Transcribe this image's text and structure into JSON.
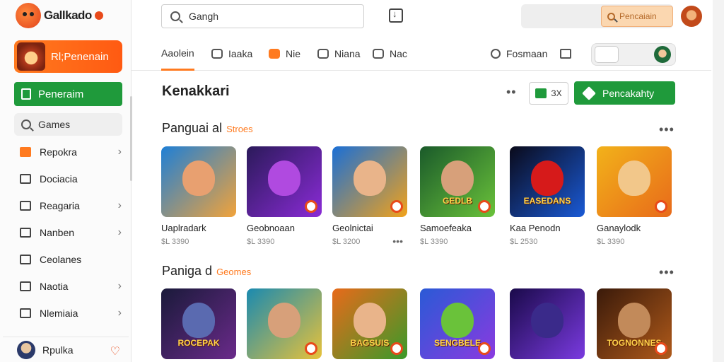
{
  "brand": {
    "name": "Gallkado"
  },
  "sidebar": {
    "profile_label": "Rl;Penenain",
    "primary_label": "Peneraim",
    "search_label": "Games",
    "items": [
      {
        "label": "Repokra",
        "icon": "orange-square-icon",
        "chevron": true
      },
      {
        "label": "Dociacia",
        "icon": "mail-icon",
        "chevron": false
      },
      {
        "label": "Reagaria",
        "icon": "calendar-icon",
        "chevron": true
      },
      {
        "label": "Nanben",
        "icon": "window-icon",
        "chevron": true
      },
      {
        "label": "Ceolanes",
        "icon": "tag-icon",
        "chevron": false
      },
      {
        "label": "Naotia",
        "icon": "pencil-icon",
        "chevron": true
      },
      {
        "label": "Nlemiaia",
        "icon": "book-icon",
        "chevron": true
      }
    ],
    "user_label": "Rpulka"
  },
  "topbar": {
    "search_value": "Gangh",
    "action_label": "Pencaiain"
  },
  "tabs": [
    {
      "label": "Aaolein",
      "active": true
    },
    {
      "label": "Iaaka",
      "active": false
    },
    {
      "label": "Nie",
      "active": false
    },
    {
      "label": "Niana",
      "active": false
    },
    {
      "label": "Nac",
      "active": false
    }
  ],
  "tabs_right": {
    "label": "Fosmaan"
  },
  "content": {
    "title": "Kenakkari",
    "outline_btn_label": "ЗX",
    "cta_label": "Pencakahty",
    "sections": [
      {
        "title": "Panguai al",
        "subtitle": "Stroes",
        "cards": [
          {
            "name": "Uaplradark",
            "price": "$L 3390",
            "colors": [
              "#1e7fd6",
              "#f2a33a"
            ],
            "face": "#e8a070",
            "text": "",
            "dots": false
          },
          {
            "name": "Geobnoaan",
            "price": "$L 3390",
            "colors": [
              "#2b1a5a",
              "#8a2bd6"
            ],
            "face": "#b04ae0",
            "text": "",
            "dots": false
          },
          {
            "name": "Geolnictai",
            "price": "$L 3200",
            "colors": [
              "#1a6fd6",
              "#f2a21a"
            ],
            "face": "#e9b48a",
            "text": "",
            "dots": true
          },
          {
            "name": "Samoefeaka",
            "price": "$L 3390",
            "colors": [
              "#1a5a2a",
              "#6ac23a"
            ],
            "face": "#d7a07a",
            "text": "GEDLB",
            "dots": false
          },
          {
            "name": "Kaa Penodn",
            "price": "$L 2530",
            "colors": [
              "#0a0a1a",
              "#1a5ad6"
            ],
            "face": "#d61a1a",
            "text": "EASEDANS",
            "dots": false
          },
          {
            "name": "Ganaylodk",
            "price": "$L 3390",
            "colors": [
              "#f2b21a",
              "#e86a1a"
            ],
            "face": "#f2c78a",
            "text": "",
            "dots": false
          }
        ]
      },
      {
        "title": "Paniga d",
        "subtitle": "Geomes",
        "cards": [
          {
            "name": "",
            "price": "",
            "colors": [
              "#1a1a3a",
              "#6a2a8a"
            ],
            "face": "#5a6ab0",
            "text": "ROCEPAK",
            "dots": false
          },
          {
            "name": "",
            "price": "",
            "colors": [
              "#1a8ab0",
              "#e8c23a"
            ],
            "face": "#d7a07a",
            "text": "",
            "dots": false
          },
          {
            "name": "",
            "price": "",
            "colors": [
              "#e86a1a",
              "#3a9a2a"
            ],
            "face": "#e9b48a",
            "text": "BAGSUIS",
            "dots": false
          },
          {
            "name": "",
            "price": "",
            "colors": [
              "#2a5ad6",
              "#8a3ae0"
            ],
            "face": "#6ac23a",
            "text": "SENGBELE",
            "dots": false
          },
          {
            "name": "",
            "price": "",
            "colors": [
              "#1a0a4a",
              "#7a3ae0"
            ],
            "face": "#3a2a8a",
            "text": "",
            "dots": false
          },
          {
            "name": "",
            "price": "",
            "colors": [
              "#3a1a0a",
              "#b05a1a"
            ],
            "face": "#c28a5a",
            "text": "TOGNONNES",
            "dots": false
          }
        ]
      }
    ]
  }
}
